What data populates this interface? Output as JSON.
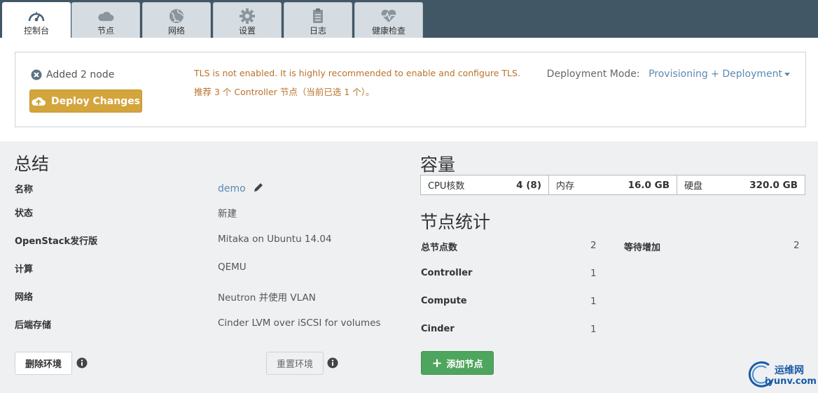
{
  "tabs": [
    {
      "label": "控制台",
      "icon": "dashboard-icon"
    },
    {
      "label": "节点",
      "icon": "cloud-icon"
    },
    {
      "label": "网络",
      "icon": "globe-icon"
    },
    {
      "label": "设置",
      "icon": "gear-icon"
    },
    {
      "label": "日志",
      "icon": "clipboard-icon"
    },
    {
      "label": "健康检查",
      "icon": "heartbeat-icon"
    }
  ],
  "notice": {
    "added_text": "Added 2 node",
    "deploy_label": "Deploy Changes",
    "warning_tls": "TLS is not enabled. It is highly recommended to enable and configure TLS.",
    "warning_controller": "推荐 3 个 Controller 节点（当前已选 1 个）。",
    "mode_label": "Deployment Mode:",
    "mode_value": "Provisioning + Deployment"
  },
  "summary": {
    "title": "总结",
    "rows": [
      {
        "label": "名称",
        "value": "demo"
      },
      {
        "label": "状态",
        "value": "新建"
      },
      {
        "label": "OpenStack发行版",
        "value": "Mitaka on Ubuntu 14.04"
      },
      {
        "label": "计算",
        "value": "QEMU"
      },
      {
        "label": "网络",
        "value": "Neutron 并使用 VLAN"
      },
      {
        "label": "后端存储",
        "value": "Cinder LVM over iSCSI for volumes"
      }
    ],
    "delete_label": "删除环境",
    "reset_label": "重置环境"
  },
  "capacity": {
    "title": "容量",
    "cells": [
      {
        "label": "CPU核数",
        "value": "4 (8)"
      },
      {
        "label": "内存",
        "value": "16.0 GB"
      },
      {
        "label": "硬盘",
        "value": "320.0 GB"
      }
    ]
  },
  "node_stats": {
    "title": "节点统计",
    "total_label": "总节点数",
    "total_value": "2",
    "pending_label": "等待增加",
    "pending_value": "2",
    "roles": [
      {
        "label": "Controller",
        "value": "1"
      },
      {
        "label": "Compute",
        "value": "1"
      },
      {
        "label": "Cinder",
        "value": "1"
      }
    ],
    "add_label": "添加节点"
  },
  "watermark": {
    "line1": "运维网",
    "line2": "iyunv.com"
  },
  "colors": {
    "topbar": "#415766",
    "deploy": "#d4a53c",
    "add": "#4ea55d",
    "link": "#5c8ab2",
    "warning": "#b9722c"
  }
}
